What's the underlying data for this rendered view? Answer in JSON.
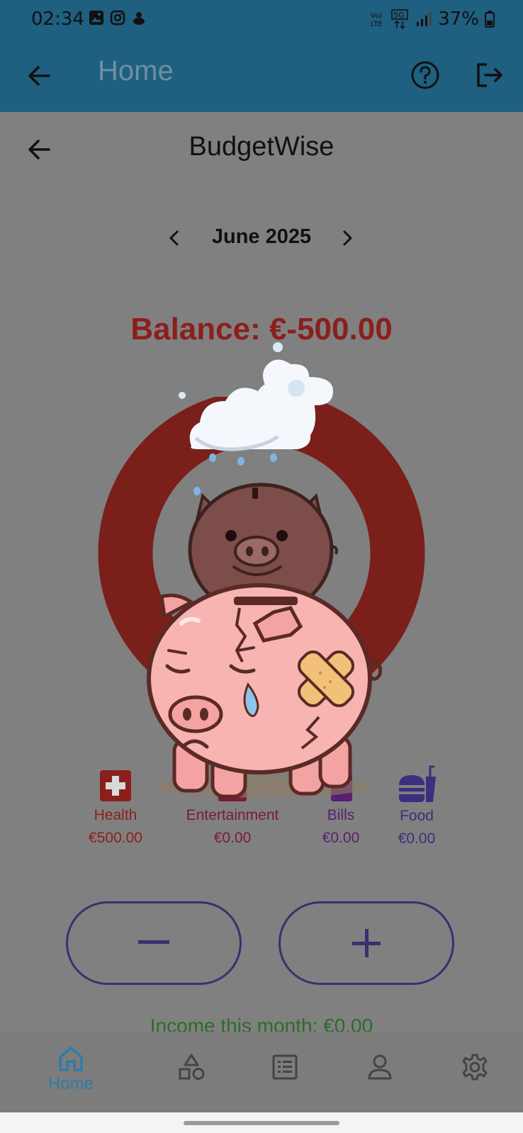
{
  "status_bar": {
    "time": "02:34",
    "battery": "37%",
    "left_icons": [
      "gallery-icon",
      "instagram-icon",
      "app-icon"
    ],
    "right_icons": [
      "volte-icon",
      "5g-icon",
      "signal-icon",
      "battery-icon"
    ]
  },
  "app_bar": {
    "title": "Home",
    "icons": [
      "back-arrow-icon",
      "help-icon",
      "logout-icon"
    ]
  },
  "page": {
    "title": "BudgetWise",
    "month": "June 2025",
    "balance": "Balance: €-500.00",
    "income": "Income this month: €0.00"
  },
  "categories": [
    {
      "label": "Health",
      "amount": "€500.00",
      "color": "#8b1f1c",
      "icon": "medical-cross-icon"
    },
    {
      "label": "Entertainment",
      "amount": "€0.00",
      "color": "#7a1a3a",
      "icon": "entertainment-icon"
    },
    {
      "label": "Bills",
      "amount": "€0.00",
      "color": "#5a1f6e",
      "icon": "bills-icon"
    },
    {
      "label": "Food",
      "amount": "€0.00",
      "color": "#3b2f7e",
      "icon": "fastfood-icon"
    }
  ],
  "buttons": {
    "expense_symbol": "−",
    "income_symbol": "+"
  },
  "bottom_nav": [
    {
      "label": "Home",
      "icon": "home-icon",
      "active": true
    },
    {
      "label": "",
      "icon": "categories-icon",
      "active": false
    },
    {
      "label": "",
      "icon": "list-icon",
      "active": false
    },
    {
      "label": "",
      "icon": "profile-icon",
      "active": false
    },
    {
      "label": "",
      "icon": "settings-icon",
      "active": false
    }
  ],
  "colors": {
    "app_bar": "#1f5f7f",
    "overlay_gray": "#808080",
    "balance_negative": "#8b1f1c",
    "ring": "#7a1f1a",
    "income_green": "#2e6b2a",
    "nav_active": "#2f7bab"
  }
}
